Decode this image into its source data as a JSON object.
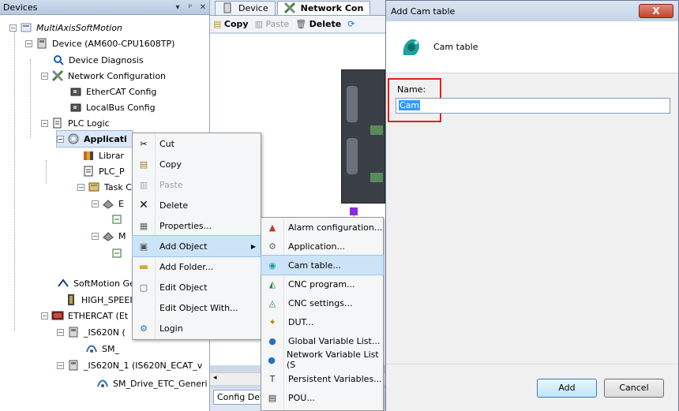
{
  "devices_panel": {
    "title": "Devices",
    "controls": [
      "▾",
      "ᵖ",
      "✕"
    ],
    "tree": [
      {
        "label": "MultiAxisSoftMotion",
        "icon": "project-icon",
        "italic": true
      },
      {
        "label": "Device (AM600-CPU1608TP)",
        "icon": "device-icon"
      },
      {
        "label": "Device Diagnosis",
        "icon": "diagnosis-icon"
      },
      {
        "label": "Network Configuration",
        "icon": "network-config-icon"
      },
      {
        "label": "EtherCAT Config",
        "icon": "ethercat-config-icon"
      },
      {
        "label": "LocalBus Config",
        "icon": "localbus-config-icon"
      },
      {
        "label": "PLC Logic",
        "icon": "plc-logic-icon"
      },
      {
        "label": "Applicati",
        "icon": "application-icon"
      },
      {
        "label": "Librar",
        "icon": "library-icon"
      },
      {
        "label": "PLC_P",
        "icon": "pou-icon"
      },
      {
        "label": "Task C",
        "icon": "task-config-icon"
      },
      {
        "label": "E",
        "icon": "task-icon"
      },
      {
        "label": "M",
        "icon": "task-icon"
      },
      {
        "label": "SoftMotion Ge",
        "icon": "softmotion-icon"
      },
      {
        "label": "HIGH_SPEEI",
        "icon": "highspeed-icon"
      },
      {
        "label": "ETHERCAT (Et",
        "icon": "ethercat-icon"
      },
      {
        "label": "_IS620N (",
        "icon": "device-icon"
      },
      {
        "label": "SM_",
        "icon": "sm-drive-icon"
      },
      {
        "label": "_IS620N_1 (IS620N_ECAT_v",
        "icon": "device-icon"
      },
      {
        "label": "SM_Drive_ETC_Generi",
        "icon": "sm-drive-icon"
      }
    ]
  },
  "editor": {
    "tabs": [
      "Device",
      "Network Con"
    ],
    "toolbar": {
      "copy": "Copy",
      "paste": "Paste",
      "delete": "Delete"
    },
    "bottom_tab": "Config Dev"
  },
  "context_menu": {
    "items": [
      {
        "label": "Cut",
        "icon": "cut-icon",
        "disabled": false
      },
      {
        "label": "Copy",
        "icon": "copy-icon",
        "disabled": false
      },
      {
        "label": "Paste",
        "icon": "paste-icon",
        "disabled": true
      },
      {
        "label": "Delete",
        "icon": "delete-icon",
        "disabled": false
      },
      {
        "label": "Properties...",
        "icon": "properties-icon",
        "disabled": false
      },
      {
        "label": "Add Object",
        "icon": "add-object-icon",
        "disabled": false,
        "highlighted": true,
        "submenu": true
      },
      {
        "label": "Add Folder...",
        "icon": "folder-icon",
        "disabled": false
      },
      {
        "label": "Edit Object",
        "icon": "edit-object-icon",
        "disabled": false
      },
      {
        "label": "Edit Object With...",
        "icon": "",
        "disabled": false
      },
      {
        "label": "Login",
        "icon": "login-icon",
        "disabled": false
      }
    ]
  },
  "submenu": {
    "items": [
      {
        "label": "Alarm configuration...",
        "icon": "alarm-icon"
      },
      {
        "label": "Application...",
        "icon": "application-icon"
      },
      {
        "label": "Cam table...",
        "icon": "cam-table-icon",
        "highlighted": true
      },
      {
        "label": "CNC program...",
        "icon": "cnc-program-icon"
      },
      {
        "label": "CNC settings...",
        "icon": "cnc-settings-icon"
      },
      {
        "label": "DUT...",
        "icon": "dut-icon"
      },
      {
        "label": "Global Variable List...",
        "icon": "globe-icon"
      },
      {
        "label": "Network Variable List (S",
        "icon": "globe-icon"
      },
      {
        "label": "Persistent Variables...",
        "icon": "persistent-icon"
      },
      {
        "label": "POU...",
        "icon": "pou-icon"
      }
    ]
  },
  "dialog": {
    "title": "Add Cam table",
    "close": "X",
    "header": "Cam table",
    "name_label": "Name:",
    "name_value": "Cam",
    "add_button": "Add",
    "cancel_button": "Cancel"
  },
  "colors": {
    "highlight": "#cce4f7",
    "red_frame": "#e0201b",
    "panel_header": "#cfdcec"
  }
}
